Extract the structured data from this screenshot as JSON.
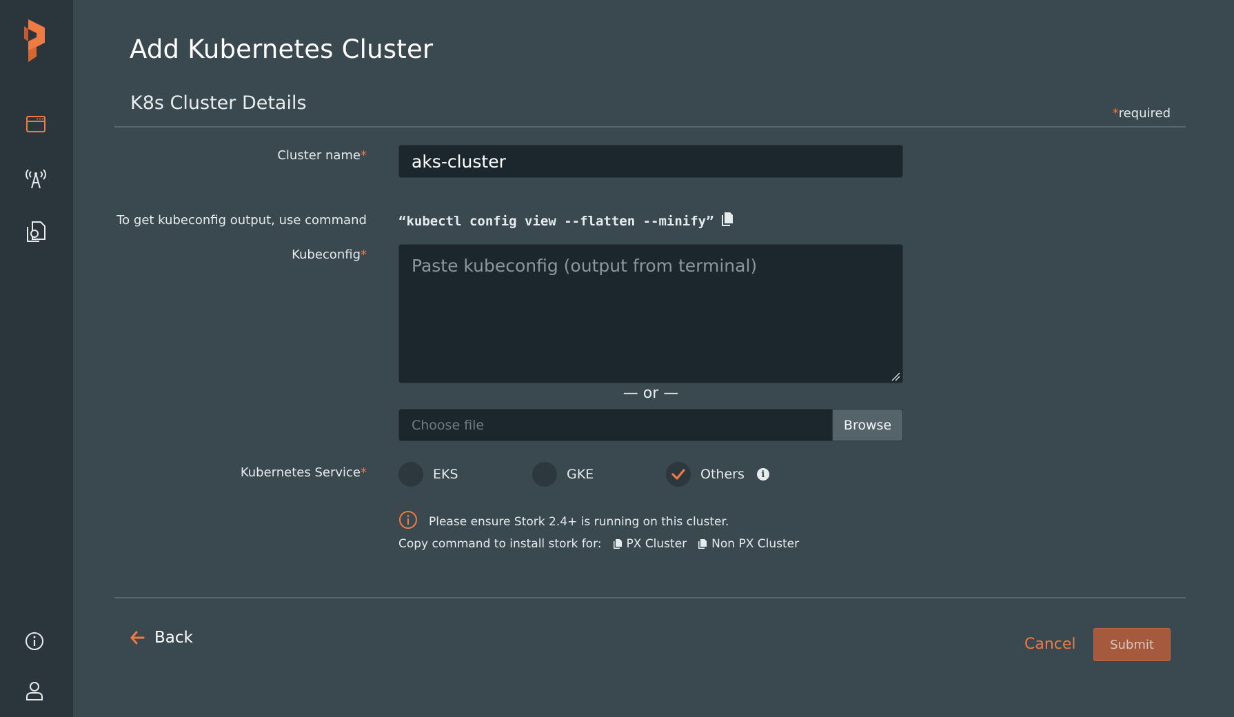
{
  "colors": {
    "accent": "#ef7a43",
    "sidebar_bg": "#2b363c",
    "page_bg": "#3a4850",
    "input_bg": "#1c272d"
  },
  "sidebar": {
    "logo": "portworx-logo",
    "items": [
      {
        "icon": "browser-window-icon"
      },
      {
        "icon": "broadcast-tower-icon"
      },
      {
        "icon": "documents-icon"
      }
    ],
    "bottom": [
      {
        "icon": "info-icon"
      },
      {
        "icon": "user-icon"
      }
    ]
  },
  "page": {
    "title": "Add Kubernetes Cluster",
    "section_title": "K8s Cluster Details",
    "required_star": "*",
    "required_text": "required"
  },
  "form": {
    "cluster_name": {
      "label": "Cluster name",
      "star": "*",
      "value": "aks-cluster"
    },
    "command_hint": {
      "label": "To get kubeconfig output, use command",
      "command": "“kubectl config view --flatten --minify”"
    },
    "kubeconfig": {
      "label": "Kubeconfig",
      "star": "*",
      "placeholder": "Paste kubeconfig (output from terminal)"
    },
    "or_divider": "— or —",
    "file": {
      "placeholder": "Choose file",
      "browse_label": "Browse"
    },
    "service": {
      "label": "Kubernetes Service",
      "star": "*",
      "options": [
        {
          "label": "EKS",
          "selected": false
        },
        {
          "label": "GKE",
          "selected": false
        },
        {
          "label": "Others",
          "selected": true
        }
      ],
      "info_glyph": "i"
    },
    "notice": "Please ensure Stork 2.4+ is running on this cluster.",
    "copy": {
      "prefix": "Copy command to install stork for:",
      "px_cluster": "PX Cluster",
      "non_px_cluster": "Non PX Cluster"
    }
  },
  "footer": {
    "back_label": "Back",
    "cancel_label": "Cancel",
    "submit_label": "Submit"
  }
}
